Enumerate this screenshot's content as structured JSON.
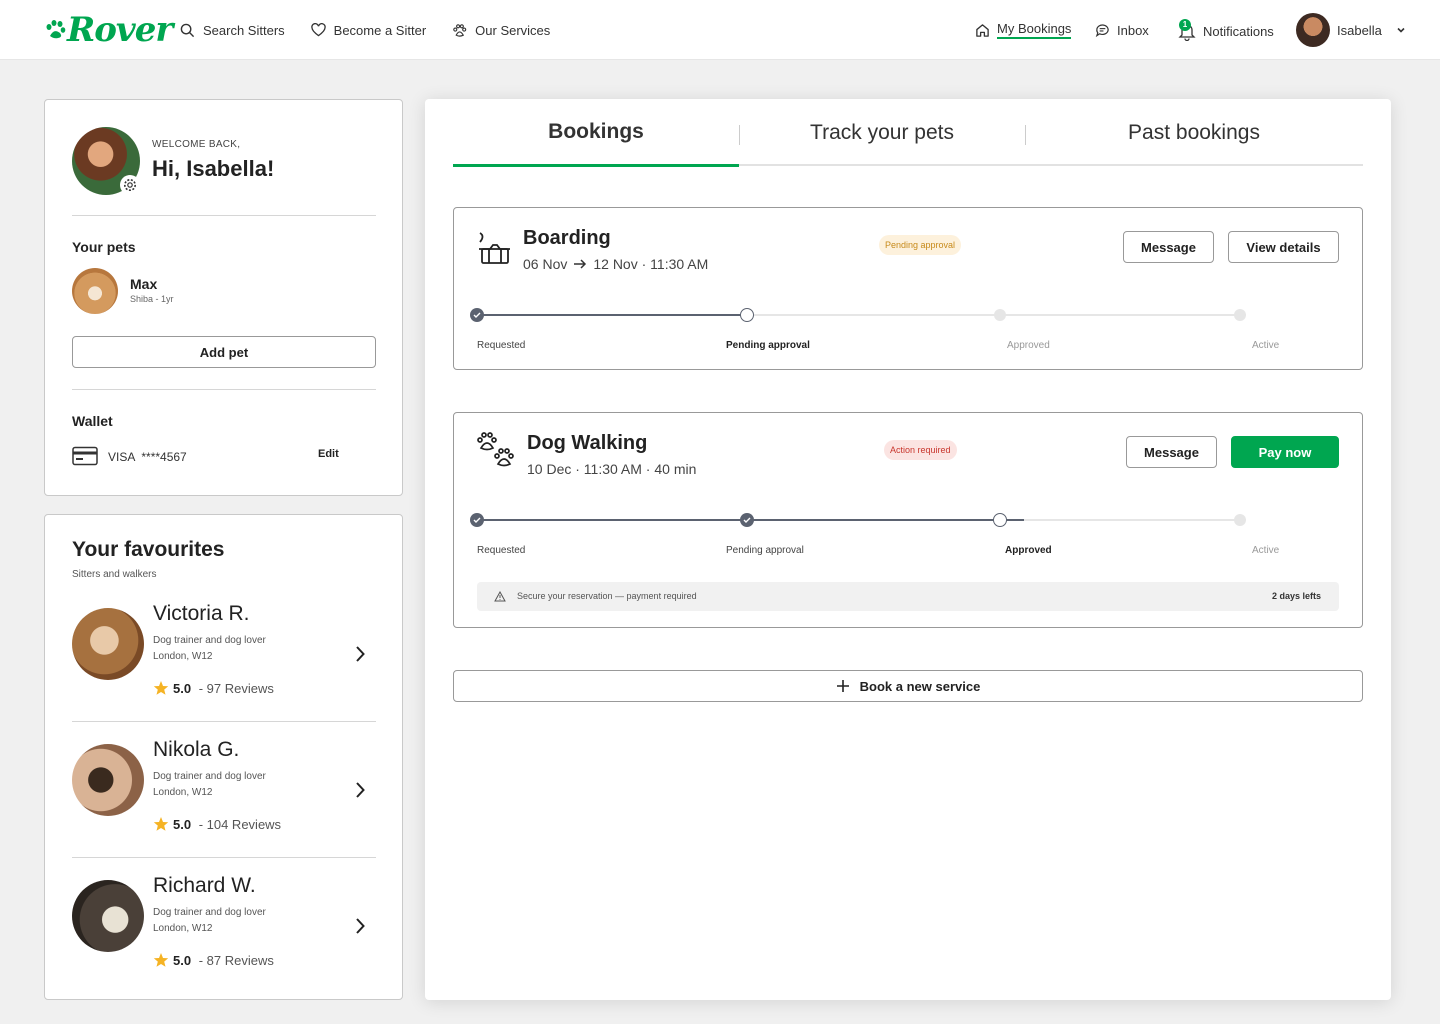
{
  "header": {
    "brand": "Rover",
    "nav": {
      "search": "Search Sitters",
      "become": "Become a Sitter",
      "services": "Our Services",
      "bookings": "My Bookings",
      "inbox": "Inbox",
      "notifications": "Notifications",
      "notifications_count": "1",
      "user": "Isabella"
    }
  },
  "profile": {
    "welcome": "WELCOME BACK,",
    "greeting": "Hi, Isabella!",
    "pets_title": "Your pets",
    "pet": {
      "name": "Max",
      "details": "Shiba - 1yr"
    },
    "add_pet": "Add pet",
    "wallet_title": "Wallet",
    "card": "VISA  ****4567",
    "edit": "Edit"
  },
  "favourites": {
    "title": "Your favourites",
    "subtitle": "Sitters and walkers",
    "sitters": [
      {
        "name": "Victoria R.",
        "desc": "Dog trainer and dog lover",
        "location": "London, W12",
        "rating": "5.0",
        "reviews": " - 97 Reviews"
      },
      {
        "name": "Nikola G.",
        "desc": "Dog trainer and dog lover",
        "location": "London, W12",
        "rating": "5.0",
        "reviews": " - 104 Reviews"
      },
      {
        "name": "Richard W.",
        "desc": "Dog trainer and dog lover",
        "location": "London, W12",
        "rating": "5.0",
        "reviews": " - 87 Reviews"
      }
    ]
  },
  "tabs": [
    "Bookings",
    "Track your pets",
    "Past bookings"
  ],
  "bookings": [
    {
      "title": "Boarding",
      "date_from": "06 Nov",
      "date_to": "12 Nov · 11:30 AM",
      "status": "Pending approval",
      "btn1": "Message",
      "btn2": "View details",
      "progress": 0.355,
      "steps": [
        "Requested",
        "Pending approval",
        "Approved",
        "Active"
      ]
    },
    {
      "title": "Dog Walking",
      "date": "10 Dec · 11:30 AM · 40 min",
      "status": "Action required",
      "btn1": "Message",
      "btn2": "Pay now",
      "progress": 0.716,
      "steps": [
        "Requested",
        "Pending approval",
        "Approved",
        "Active"
      ],
      "notice": "Secure your reservation — payment required",
      "notice_right": "2 days lefts"
    }
  ],
  "book_new": "Book a new service",
  "colors": {
    "brand": "#00a650",
    "pending": "#c78a1a",
    "action": "#c8362d"
  }
}
